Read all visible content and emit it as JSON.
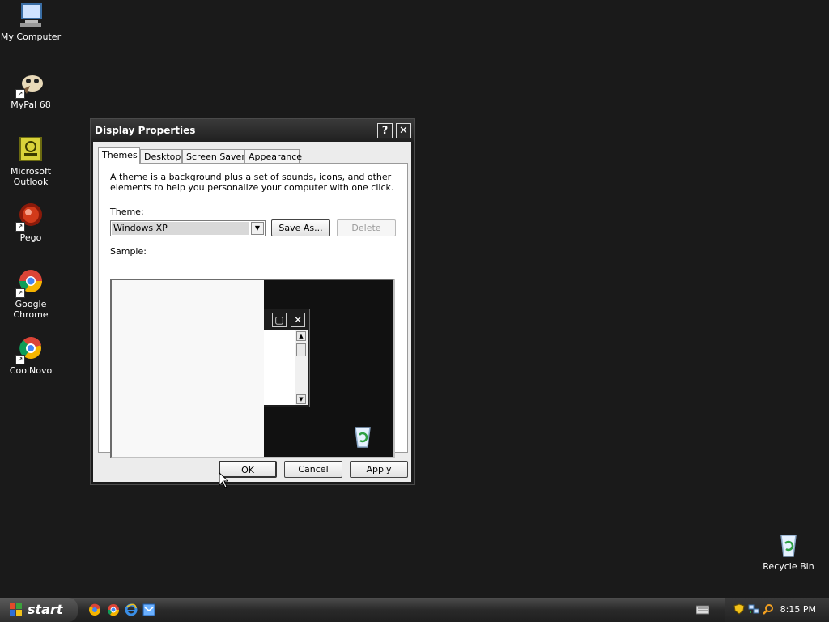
{
  "desktop": {
    "icons": [
      {
        "label": "My Computer"
      },
      {
        "label": "MyPal 68"
      },
      {
        "label": "Microsoft Outlook"
      },
      {
        "label": "Pego"
      },
      {
        "label": "Google Chrome"
      },
      {
        "label": "CoolNovo"
      },
      {
        "label": "Recycle Bin"
      }
    ]
  },
  "dialog": {
    "title": "Display Properties",
    "help_label": "?",
    "close_label": "✕",
    "tabs": [
      {
        "label": "Themes"
      },
      {
        "label": "Desktop"
      },
      {
        "label": "Screen Saver"
      },
      {
        "label": "Appearance"
      }
    ],
    "description": "A theme is a background plus a set of sounds, icons, and other elements to help you personalize your computer with one click.",
    "theme_label": "Theme:",
    "theme_value": "Windows XP",
    "save_as_label": "Save As...",
    "delete_label": "Delete",
    "sample_label": "Sample:",
    "ok_label": "OK",
    "cancel_label": "Cancel",
    "apply_label": "Apply"
  },
  "taskbar": {
    "start_label": "start",
    "clock": "8:15 PM"
  }
}
